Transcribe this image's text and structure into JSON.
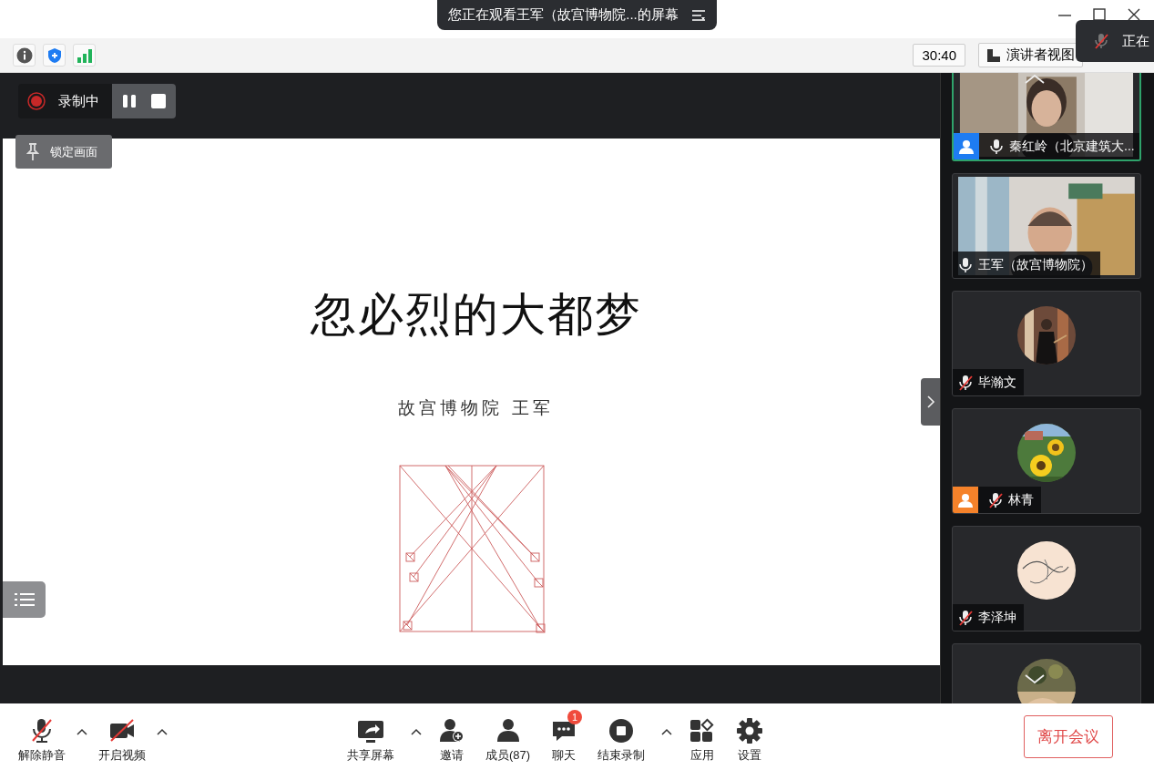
{
  "banner": {
    "text": "您正在观看王军（故宫博物院...的屏幕"
  },
  "toast": {
    "text": "正在"
  },
  "toolbar": {
    "timer": "30:40",
    "view_button": "演讲者视图"
  },
  "recording": {
    "label": "录制中"
  },
  "lock_button": "锁定画面",
  "slide": {
    "title": "忽必烈的大都梦",
    "subtitle": "故宫博物院 王军"
  },
  "participants": [
    {
      "kind": "video",
      "name": "秦红岭（北京建筑大...",
      "muted": false,
      "speaking": true,
      "color": "#1e7cf2"
    },
    {
      "kind": "video",
      "name": "王军（故宫博物院）",
      "muted": false,
      "speaking": false
    },
    {
      "kind": "avatar",
      "name": "毕瀚文",
      "muted": true,
      "speaking": false
    },
    {
      "kind": "avatar",
      "name": "林青",
      "muted": true,
      "speaking": false,
      "color": "#f5822a"
    },
    {
      "kind": "avatar",
      "name": "李泽坤",
      "muted": true,
      "speaking": false
    },
    {
      "kind": "avatar",
      "speaking": false
    }
  ],
  "controls": [
    {
      "kind": "unmute",
      "label": "解除静音",
      "caret": true
    },
    {
      "kind": "camera",
      "label": "开启视频",
      "caret": true
    },
    {
      "kind": "share",
      "label": "共享屏幕",
      "caret": true
    },
    {
      "kind": "invite",
      "label": "邀请",
      "caret": false
    },
    {
      "kind": "members",
      "label": "成员(87)",
      "caret": false
    },
    {
      "kind": "chat",
      "label": "聊天",
      "caret": false,
      "badge": "1"
    },
    {
      "kind": "recording",
      "label": "结束录制",
      "caret": true
    },
    {
      "kind": "apps",
      "label": "应用",
      "caret": false
    },
    {
      "kind": "settings",
      "label": "设置",
      "caret": false
    }
  ],
  "leave_button": "离开会议"
}
